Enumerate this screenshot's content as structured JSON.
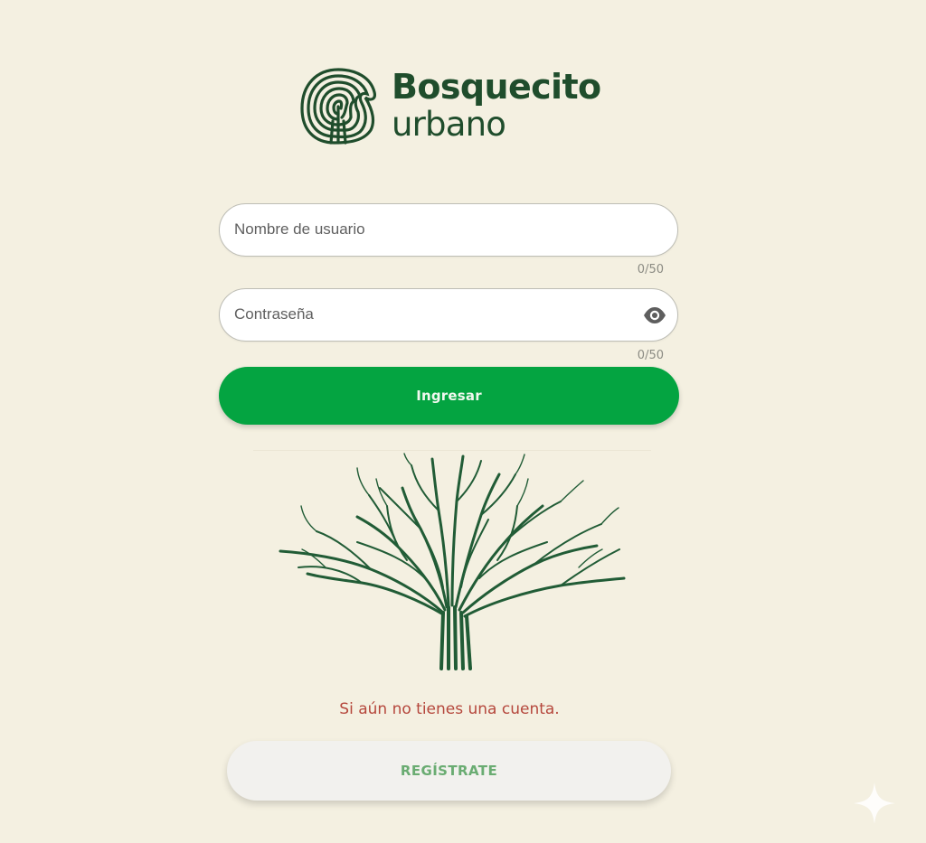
{
  "brand": {
    "line1": "Bosquecito",
    "line2": "urbano"
  },
  "login_form": {
    "username": {
      "placeholder": "Nombre de usuario",
      "value": "",
      "counter": "0/50"
    },
    "password": {
      "placeholder": "Contraseña",
      "value": "",
      "counter": "0/50"
    },
    "submit_label": "Ingresar"
  },
  "signup": {
    "prompt": "Si aún no tienes una cuenta.",
    "button_label": "REGÍSTRATE"
  },
  "icons": {
    "logo": "tree-ring-logo-icon",
    "password_toggle": "eye-icon",
    "illustration": "tree-icon",
    "corner": "sparkle-icon"
  },
  "colors": {
    "background": "#f4f0e1",
    "brand_green": "#1f4d2c",
    "primary_button": "#04a441",
    "secondary_button_text": "#6aac72",
    "prompt_text": "#b5473c"
  }
}
